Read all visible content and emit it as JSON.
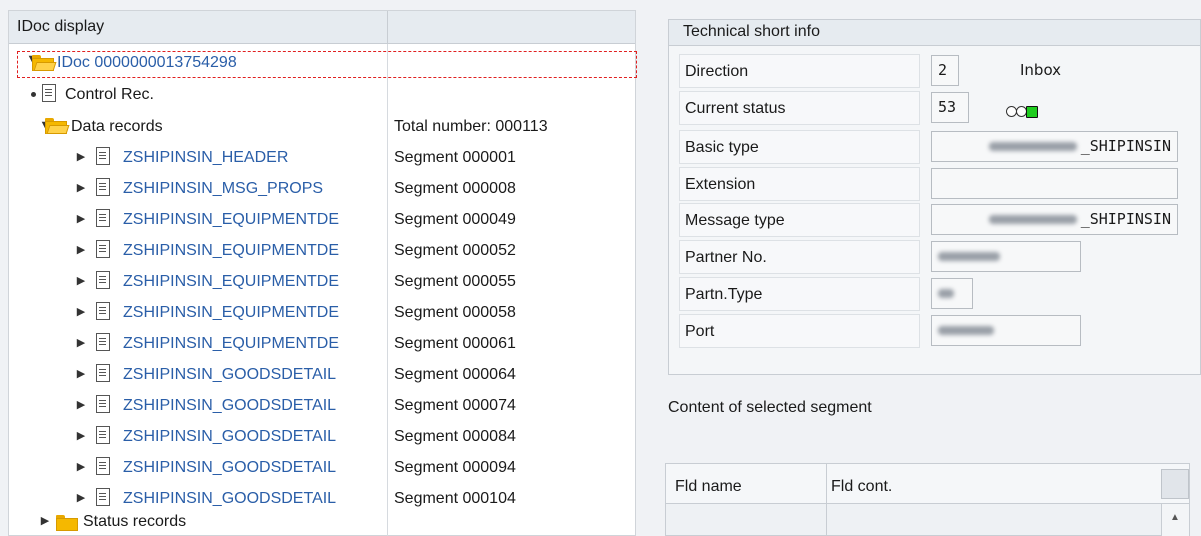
{
  "tree": {
    "header": "IDoc display",
    "root_label": "IDoc 0000000013754298",
    "control_rec": "Control Rec.",
    "data_records": {
      "label": "Data records",
      "total": "Total number: 000113"
    },
    "segments": [
      {
        "name": "ZSHIPINSIN_HEADER",
        "seg": "Segment 000001"
      },
      {
        "name": "ZSHIPINSIN_MSG_PROPS",
        "seg": "Segment 000008"
      },
      {
        "name": "ZSHIPINSIN_EQUIPMENTDE",
        "seg": "Segment 000049"
      },
      {
        "name": "ZSHIPINSIN_EQUIPMENTDE",
        "seg": "Segment 000052"
      },
      {
        "name": "ZSHIPINSIN_EQUIPMENTDE",
        "seg": "Segment 000055"
      },
      {
        "name": "ZSHIPINSIN_EQUIPMENTDE",
        "seg": "Segment 000058"
      },
      {
        "name": "ZSHIPINSIN_EQUIPMENTDE",
        "seg": "Segment 000061"
      },
      {
        "name": "ZSHIPINSIN_GOODSDETAIL",
        "seg": "Segment 000064"
      },
      {
        "name": "ZSHIPINSIN_GOODSDETAIL",
        "seg": "Segment 000074"
      },
      {
        "name": "ZSHIPINSIN_GOODSDETAIL",
        "seg": "Segment 000084"
      },
      {
        "name": "ZSHIPINSIN_GOODSDETAIL",
        "seg": "Segment 000094"
      },
      {
        "name": "ZSHIPINSIN_GOODSDETAIL",
        "seg": "Segment 000104"
      }
    ],
    "status_records": "Status records"
  },
  "tech": {
    "header": "Technical short info",
    "direction": {
      "label": "Direction",
      "value": "2",
      "text": "Inbox"
    },
    "current_status": {
      "label": "Current status",
      "value": "53"
    },
    "basic_type": {
      "label": "Basic type",
      "value": "_SHIPINSIN"
    },
    "extension": {
      "label": "Extension",
      "value": ""
    },
    "message_type": {
      "label": "Message type",
      "value": "_SHIPINSIN"
    },
    "partner_no": {
      "label": "Partner No."
    },
    "partn_type": {
      "label": "Partn.Type"
    },
    "port": {
      "label": "Port"
    }
  },
  "content": {
    "title": "Content of selected segment",
    "col_fld_name": "Fld name",
    "col_fld_cont": "Fld cont."
  },
  "colors": {
    "link": "#2a5ea8",
    "status_green": "#1fcc1f",
    "folder": "#f5b800",
    "selection": "#e02020"
  }
}
